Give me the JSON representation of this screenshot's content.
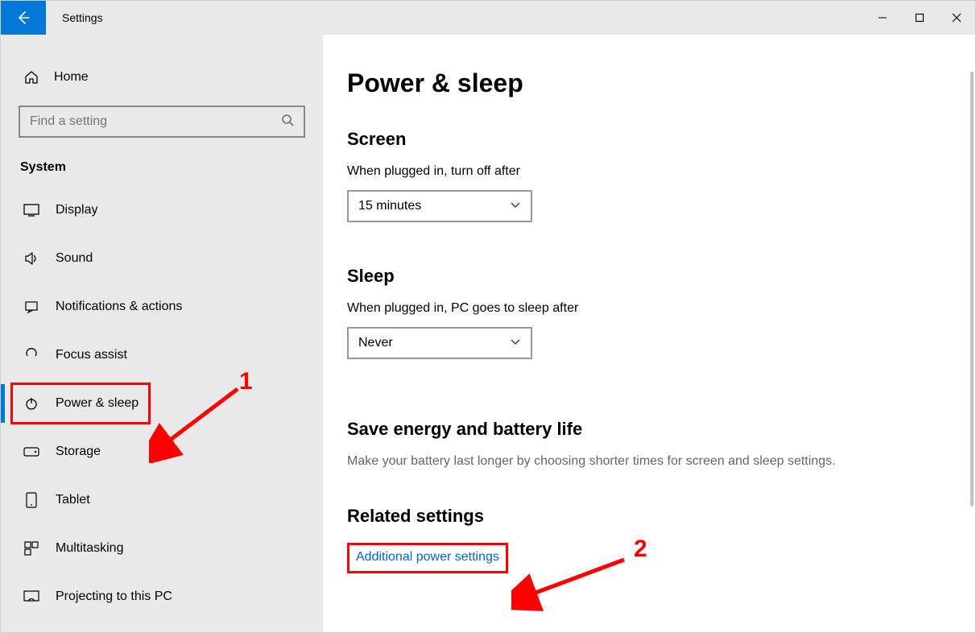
{
  "titlebar": {
    "title": "Settings"
  },
  "sidebar": {
    "home": "Home",
    "search_placeholder": "Find a setting",
    "group": "System",
    "items": [
      {
        "label": "Display"
      },
      {
        "label": "Sound"
      },
      {
        "label": "Notifications & actions"
      },
      {
        "label": "Focus assist"
      },
      {
        "label": "Power & sleep"
      },
      {
        "label": "Storage"
      },
      {
        "label": "Tablet"
      },
      {
        "label": "Multitasking"
      },
      {
        "label": "Projecting to this PC"
      }
    ]
  },
  "main": {
    "title": "Power & sleep",
    "screen": {
      "heading": "Screen",
      "label": "When plugged in, turn off after",
      "value": "15 minutes"
    },
    "sleep": {
      "heading": "Sleep",
      "label": "When plugged in, PC goes to sleep after",
      "value": "Never"
    },
    "energy": {
      "heading": "Save energy and battery life",
      "desc": "Make your battery last longer by choosing shorter times for screen and sleep settings."
    },
    "related": {
      "heading": "Related settings",
      "link": "Additional power settings"
    }
  },
  "annotations": {
    "one": "1",
    "two": "2"
  }
}
